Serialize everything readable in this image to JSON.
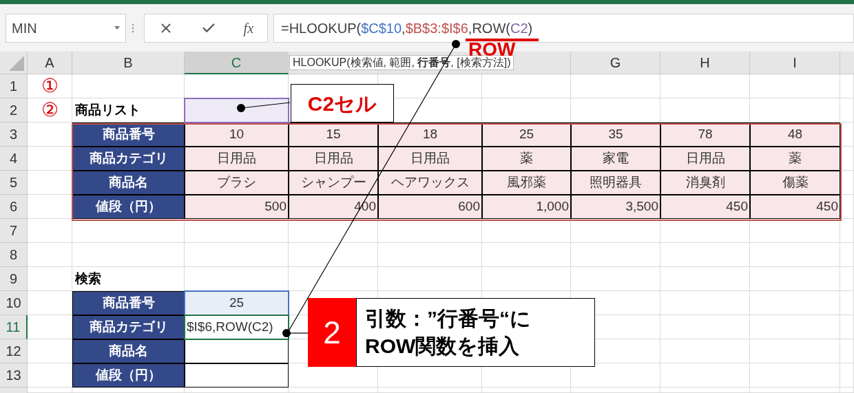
{
  "name_box": {
    "value": "MIN"
  },
  "formula_bar": {
    "fx": "fx",
    "parts": [
      {
        "text": "=HLOOKUP("
      },
      {
        "text": "$C$10",
        "color": "#4472c4"
      },
      {
        "text": ","
      },
      {
        "text": "$B$3:$I$6",
        "color": "#c0504d"
      },
      {
        "text": ",ROW("
      },
      {
        "text": "C2",
        "color": "#8064a2"
      },
      {
        "text": ")"
      }
    ]
  },
  "tooltip": "HLOOKUP(検索値, 範囲, **行番号**, [検索方法])",
  "row_label": "ROW",
  "columns_left": [
    {
      "label": "A",
      "selected": false
    },
    {
      "label": "B",
      "selected": false
    },
    {
      "label": "C",
      "selected": true
    }
  ],
  "columns_right": [
    {
      "label": "G",
      "selected": false
    },
    {
      "label": "H",
      "selected": false
    },
    {
      "label": "I",
      "selected": false
    }
  ],
  "rows": [
    {
      "label": "1",
      "selected": false
    },
    {
      "label": "2",
      "selected": false
    },
    {
      "label": "3",
      "selected": false
    },
    {
      "label": "4",
      "selected": false
    },
    {
      "label": "5",
      "selected": false
    },
    {
      "label": "6",
      "selected": false
    },
    {
      "label": "7",
      "selected": false
    },
    {
      "label": "8",
      "selected": false
    },
    {
      "label": "9",
      "selected": false
    },
    {
      "label": "10",
      "selected": false
    },
    {
      "label": "11",
      "selected": true
    },
    {
      "label": "12",
      "selected": false
    },
    {
      "label": "13",
      "selected": false
    }
  ],
  "markers": [
    "①",
    "②"
  ],
  "product_list": {
    "title": "商品リスト",
    "headers": [
      "商品番号",
      "商品カテゴリ",
      "商品名",
      "値段（円）"
    ],
    "rows": [
      [
        "10",
        "15",
        "18",
        "25",
        "35",
        "78",
        "48"
      ],
      [
        "日用品",
        "日用品",
        "日用品",
        "薬",
        "家電",
        "日用品",
        "薬"
      ],
      [
        "ブラシ",
        "シャンプー",
        "ヘアワックス",
        "風邪薬",
        "照明器具",
        "消臭剤",
        "傷薬"
      ],
      [
        "500",
        "400",
        "600",
        "1,000",
        "3,500",
        "450",
        "450"
      ]
    ]
  },
  "search": {
    "title": "検索",
    "headers": [
      "商品番号",
      "商品カテゴリ",
      "商品名",
      "値段（円）"
    ],
    "values": [
      "25",
      "$I$6,ROW(C2)"
    ]
  },
  "callouts": [
    {
      "kind": "label",
      "text": "C2セル"
    },
    {
      "kind": "step",
      "number": "2",
      "text": "引数：”行番号“に\nROW関数を挿入"
    }
  ]
}
